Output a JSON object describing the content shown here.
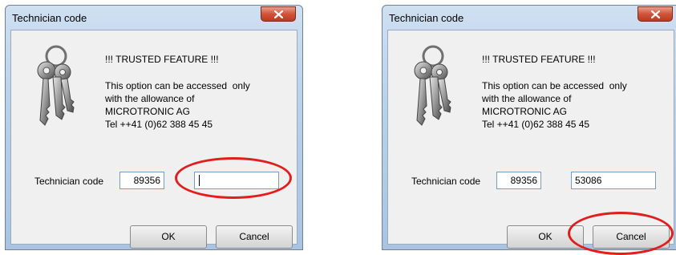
{
  "dialogs": [
    {
      "title": "Technician code",
      "heading": "!!! TRUSTED FEATURE !!!",
      "message_lines": [
        "This option can be accessed  only",
        "with the allowance of",
        "MICROTRONIC AG",
        "Tel ++41 (0)62 388 45 45"
      ],
      "code_label": "Technician code",
      "code_value": "89356",
      "response_value": "",
      "ok_label": "OK",
      "cancel_label": "Cancel"
    },
    {
      "title": "Technician code",
      "heading": "!!! TRUSTED FEATURE !!!",
      "message_lines": [
        "This option can be accessed  only",
        "with the allowance of",
        "MICROTRONIC AG",
        "Tel ++41 (0)62 388 45 45"
      ],
      "code_label": "Technician code",
      "code_value": "89356",
      "response_value": "53086",
      "ok_label": "OK",
      "cancel_label": "Cancel"
    }
  ],
  "icons": {
    "close": "close-x-icon",
    "keys": "keys-icon"
  },
  "colors": {
    "highlight": "#e01e1e",
    "close_button": "#d1533a"
  }
}
